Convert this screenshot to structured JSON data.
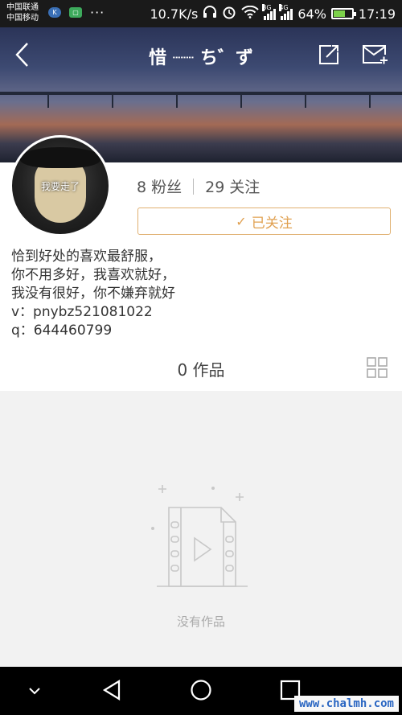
{
  "status_bar": {
    "carrier_1": "中国联通",
    "carrier_2": "中国移动",
    "speed": "10.7K/s",
    "net_3g": "3G",
    "net_4g": "4G",
    "battery": "64%",
    "battery_level": 0.64,
    "time": "17:19"
  },
  "header": {
    "title": "惜 ┈┈ ち゛ず",
    "icons": [
      "back-icon",
      "share-icon",
      "message-icon"
    ]
  },
  "avatar": {
    "caption": "我要走了"
  },
  "stats": {
    "fans_count": "8",
    "fans_label": "粉丝",
    "following_count": "29",
    "following_label": "关注"
  },
  "follow_button": {
    "icon": "✓",
    "label": "已关注"
  },
  "bio": {
    "lines": [
      "恰到好处的喜欢最舒服，",
      "你不用多好，我喜欢就好，",
      "我没有很好，你不嫌弃就好",
      "v：pnybz521081022",
      "q：644460799"
    ]
  },
  "works": {
    "label": "0 作品"
  },
  "empty_state": {
    "text": "没有作品"
  },
  "watermark": "www.chalmh.com",
  "colors": {
    "accent": "#e0a050",
    "status_bar": "#1a1a1a",
    "empty_bg": "#f2f2f2"
  }
}
